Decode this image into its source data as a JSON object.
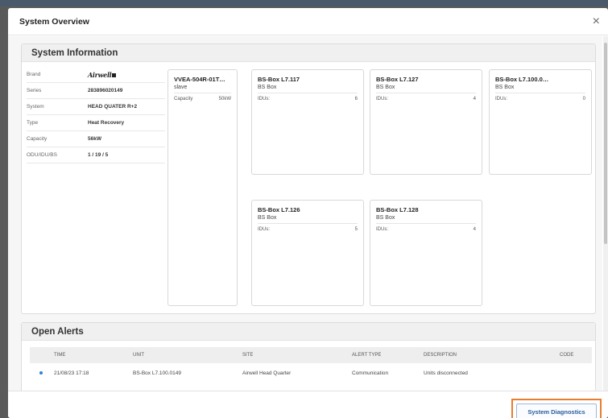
{
  "window": {
    "title": "System Overview",
    "close_glyph": "×"
  },
  "system_info": {
    "title": "System Information",
    "rows": [
      {
        "key": "Brand",
        "value": "Airwell"
      },
      {
        "key": "Series",
        "value": "283896020149"
      },
      {
        "key": "System",
        "value": "HEAD QUATER R+2"
      },
      {
        "key": "Type",
        "value": "Heat Recovery"
      },
      {
        "key": "Capacity",
        "value": "56kW"
      },
      {
        "key": "ODU/IDU/BS",
        "value": "1 / 19 / 5"
      }
    ],
    "odu": {
      "name": "VVEA-504R-01T…",
      "type": "slave",
      "field_label": "Capacity",
      "field_value": "50kW"
    },
    "bs_boxes": [
      {
        "name": "BS-Box L7.117",
        "type": "BS Box",
        "field_label": "IDUs:",
        "field_value": "6"
      },
      {
        "name": "BS-Box L7.127",
        "type": "BS Box",
        "field_label": "IDUs:",
        "field_value": "4"
      },
      {
        "name": "BS-Box L7.100.0…",
        "type": "BS Box",
        "field_label": "IDUs:",
        "field_value": "0"
      },
      {
        "name": "BS-Box L7.126",
        "type": "BS Box",
        "field_label": "IDUs:",
        "field_value": "5"
      },
      {
        "name": "BS-Box L7.128",
        "type": "BS Box",
        "field_label": "IDUs:",
        "field_value": "4"
      }
    ]
  },
  "alerts": {
    "title": "Open Alerts",
    "columns": {
      "time": "TIME",
      "unit": "UNIT",
      "site": "SITE",
      "alert_type": "ALERT TYPE",
      "description": "DESCRIPTION",
      "code": "CODE"
    },
    "rows": [
      {
        "time": "21/08/23  17:18",
        "unit": "BS-Box L7.100.0149",
        "site": "Airwell Head Quarter",
        "alert_type": "Communication",
        "description": "Units disconnected",
        "code": ""
      }
    ]
  },
  "footer": {
    "diagnostics_label": "System Diagnostics"
  },
  "colors": {
    "accent": "#2a5d9c",
    "highlight": "#e97d2f",
    "bullet": "#2f7fd8"
  }
}
